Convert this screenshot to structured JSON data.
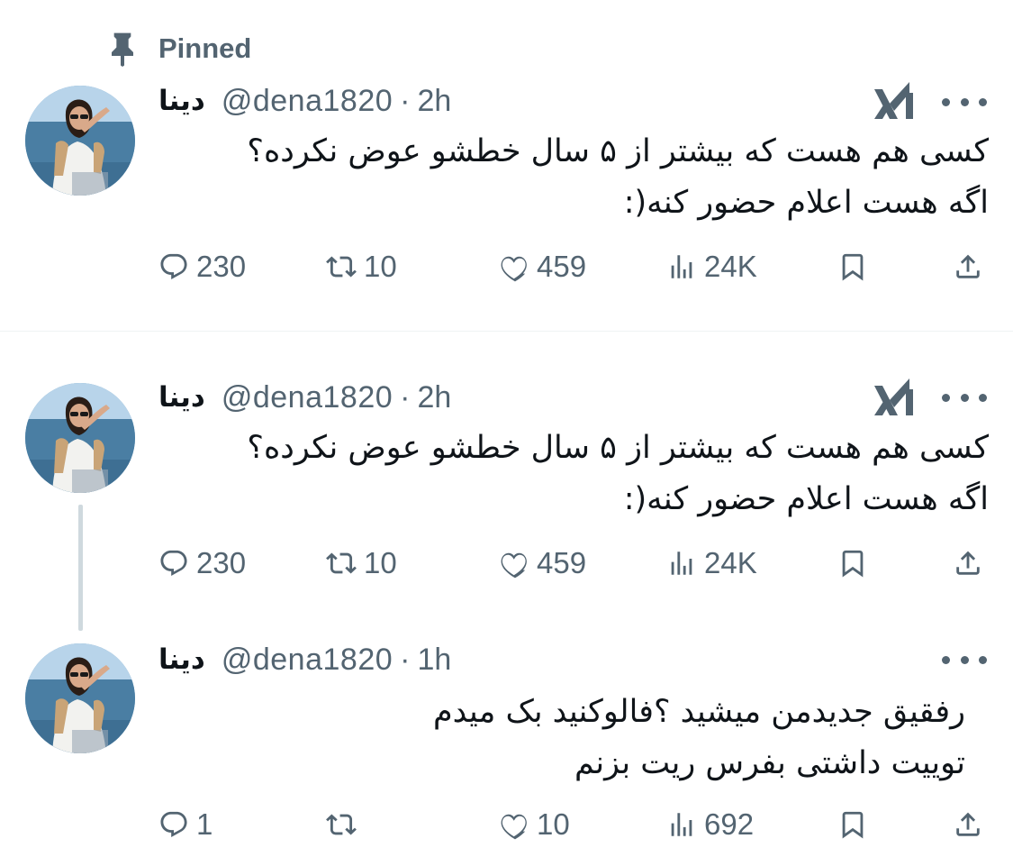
{
  "pinned_label": "Pinned",
  "tweets": [
    {
      "author_name": "دینا",
      "handle": "@dena1820",
      "separator": "·",
      "time": "2h",
      "show_grok": true,
      "lines": [
        "کسی هم هست که بیشتر از ۵ سال خطشو عوض نکرده؟",
        "اگه هست اعلام حضور کنه(:"
      ],
      "replies": "230",
      "retweets": "10",
      "likes": "459",
      "views": "24K"
    },
    {
      "author_name": "دینا",
      "handle": "@dena1820",
      "separator": "·",
      "time": "2h",
      "show_grok": true,
      "lines": [
        "کسی هم هست که بیشتر از ۵ سال خطشو عوض نکرده؟",
        "اگه هست اعلام حضور کنه(:"
      ],
      "replies": "230",
      "retweets": "10",
      "likes": "459",
      "views": "24K"
    },
    {
      "author_name": "دینا",
      "handle": "@dena1820",
      "separator": "·",
      "time": "1h",
      "show_grok": false,
      "lines": [
        "رفقیق جدیدمن میشید ؟فالوکنید بک میدم",
        "توییت داشتی بفرس ریت بزنم"
      ],
      "replies": "1",
      "retweets": "",
      "likes": "10",
      "views": "692"
    }
  ],
  "icons": {
    "pin": "pin-icon",
    "grok": "grok-icon",
    "more": "more-icon",
    "reply": "reply-icon",
    "retweet": "retweet-icon",
    "like": "like-icon",
    "views": "views-icon",
    "bookmark": "bookmark-icon",
    "share": "share-icon"
  },
  "colors": {
    "text_primary": "#0f1419",
    "text_secondary": "#536471",
    "divider": "#eff3f4",
    "thread_line": "#cfd9de"
  }
}
